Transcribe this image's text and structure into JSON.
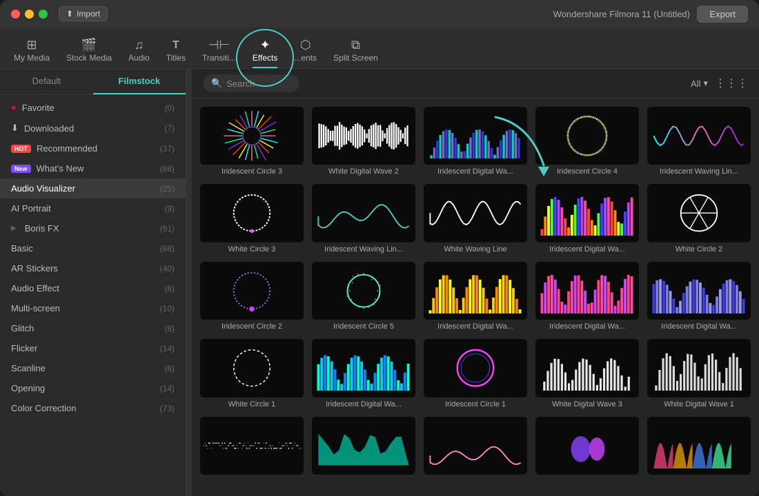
{
  "app": {
    "title": "Wondershare Filmora 11 (Untitled)"
  },
  "titleBar": {
    "import_label": "Import",
    "export_label": "Export"
  },
  "topNav": {
    "items": [
      {
        "id": "my-media",
        "label": "My Media",
        "icon": "⊞"
      },
      {
        "id": "stock-media",
        "label": "Stock Media",
        "icon": "🎬"
      },
      {
        "id": "audio",
        "label": "Audio",
        "icon": "🎵"
      },
      {
        "id": "titles",
        "label": "Titles",
        "icon": "T"
      },
      {
        "id": "transitions",
        "label": "Transiti...",
        "icon": "⊣⊢"
      },
      {
        "id": "effects",
        "label": "Effects",
        "icon": "✦",
        "active": true
      },
      {
        "id": "elements",
        "label": "...ents",
        "icon": "⬡"
      },
      {
        "id": "split-screen",
        "label": "Split Screen",
        "icon": "⧉"
      }
    ]
  },
  "sidebar": {
    "tabs": [
      {
        "id": "default",
        "label": "Default"
      },
      {
        "id": "filmstock",
        "label": "Filmstock",
        "active": true
      }
    ],
    "items": [
      {
        "id": "favorite",
        "label": "Favorite",
        "icon": "♥",
        "count": "(0)"
      },
      {
        "id": "downloaded",
        "label": "Downloaded",
        "icon": "⬇",
        "count": "(7)"
      },
      {
        "id": "recommended",
        "label": "Recommended",
        "badge": "HOT",
        "badge_type": "hot",
        "count": "(37)"
      },
      {
        "id": "whats-new",
        "label": "What's New",
        "badge": "New",
        "badge_type": "new",
        "count": "(88)"
      },
      {
        "id": "audio-visualizer",
        "label": "Audio Visualizer",
        "count": "(25)",
        "active": true
      },
      {
        "id": "ai-portrait",
        "label": "AI Portrait",
        "count": "(9)"
      },
      {
        "id": "boris-fx",
        "label": "Boris FX",
        "count": "(91)",
        "has_arrow": true
      },
      {
        "id": "basic",
        "label": "Basic",
        "count": "(68)"
      },
      {
        "id": "ar-stickers",
        "label": "AR Stickers",
        "count": "(40)"
      },
      {
        "id": "audio-effect",
        "label": "Audio Effect",
        "count": "(8)"
      },
      {
        "id": "multi-screen",
        "label": "Multi-screen",
        "count": "(10)"
      },
      {
        "id": "glitch",
        "label": "Glitch",
        "count": "(8)"
      },
      {
        "id": "flicker",
        "label": "Flicker",
        "count": "(14)"
      },
      {
        "id": "scanline",
        "label": "Scanline",
        "count": "(6)"
      },
      {
        "id": "opening",
        "label": "Opening",
        "count": "(14)"
      },
      {
        "id": "color-correction",
        "label": "Color Correction",
        "count": "(73)"
      }
    ]
  },
  "toolbar": {
    "search_placeholder": "Search",
    "all_label": "All",
    "dropdown_icon": "▾"
  },
  "effects": [
    {
      "id": 1,
      "label": "Iridescent Circle 3",
      "type": "iridescent-circle"
    },
    {
      "id": 2,
      "label": "White  Digital Wave 2",
      "type": "white-digital-wave"
    },
    {
      "id": 3,
      "label": "Iridescent Digital Wa...",
      "type": "iridescent-digital-wave-bars"
    },
    {
      "id": 4,
      "label": "Iridescent Circle 4",
      "type": "iridescent-circle-4"
    },
    {
      "id": 5,
      "label": "Iridescent Waving Lin...",
      "type": "iridescent-waving-line"
    },
    {
      "id": 6,
      "label": "White Circle 3",
      "type": "white-circle"
    },
    {
      "id": 7,
      "label": "Iridescent Waving Lin...",
      "type": "iridescent-wave-2"
    },
    {
      "id": 8,
      "label": "White Waving Line",
      "type": "white-waving-line"
    },
    {
      "id": 9,
      "label": "Iridescent Digital Wa...",
      "type": "iridescent-bars-multicolor"
    },
    {
      "id": 10,
      "label": "White Circle 2",
      "type": "white-circle-2"
    },
    {
      "id": 11,
      "label": "Iridescent Circle 2",
      "type": "iridescent-circle-2"
    },
    {
      "id": 12,
      "label": "Iridescent Circle 5",
      "type": "iridescent-circle-5"
    },
    {
      "id": 13,
      "label": "Iridescent Digital Wa...",
      "type": "iridescent-bars-yellow"
    },
    {
      "id": 14,
      "label": "Iridescent Digital Wa...",
      "type": "iridescent-bars-pink"
    },
    {
      "id": 15,
      "label": "Iridescent Digital Wa...",
      "type": "iridescent-bars-wave"
    },
    {
      "id": 16,
      "label": "White Circle 1",
      "type": "white-circle-1"
    },
    {
      "id": 17,
      "label": "Iridescent Digital Wa...",
      "type": "iridescent-bars-teal"
    },
    {
      "id": 18,
      "label": "Iridescent Circle 1",
      "type": "iridescent-circle-1"
    },
    {
      "id": 19,
      "label": "White Digital Wave 3",
      "type": "white-bars-3"
    },
    {
      "id": 20,
      "label": "White Digital Wave 1",
      "type": "white-bars-1"
    },
    {
      "id": 21,
      "label": "",
      "type": "white-pixel-row"
    },
    {
      "id": 22,
      "label": "",
      "type": "teal-mountains"
    },
    {
      "id": 23,
      "label": "",
      "type": "pink-wave-flat"
    },
    {
      "id": 24,
      "label": "",
      "type": "purple-bird"
    },
    {
      "id": 25,
      "label": "",
      "type": "colorful-mountains"
    }
  ]
}
